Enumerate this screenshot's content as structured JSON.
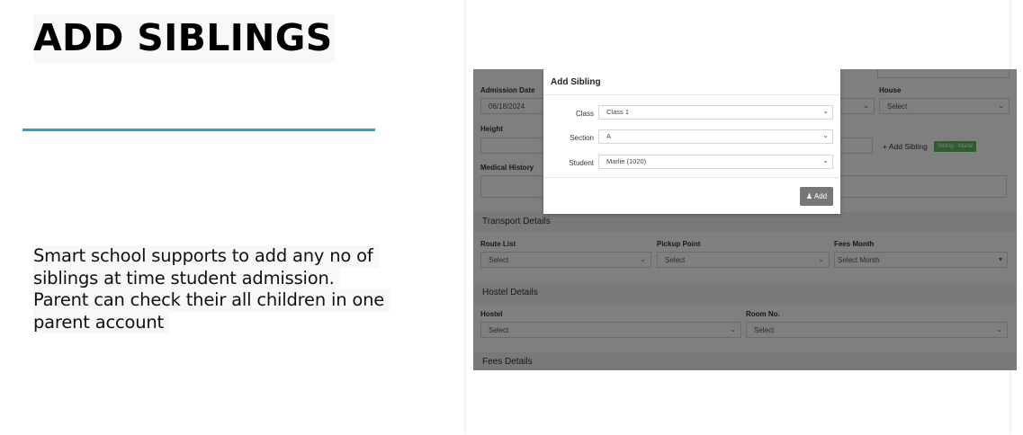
{
  "heading": "ADD SIBLINGS",
  "description_lines": [
    "Smart school supports to add any no of",
    "siblings at time student admission.",
    "Parent can check their all children in one",
    "parent account"
  ],
  "form": {
    "admission_date_label": "Admission Date",
    "admission_date_value": "06/18/2024",
    "house_label": "House",
    "house_value": "Select",
    "height_label": "Height",
    "add_sibling_label": "+ Add Sibling",
    "sibling_badge": "Sibling : Marlie",
    "medical_history_label": "Medical History",
    "transport": {
      "title": "Transport Details",
      "route_list_label": "Route List",
      "route_list_value": "Select",
      "pickup_point_label": "Pickup Point",
      "pickup_point_value": "Select",
      "fees_month_label": "Fees Month",
      "fees_month_value": "Select Month"
    },
    "hostel": {
      "title": "Hostel Details",
      "hostel_label": "Hostel",
      "hostel_value": "Select",
      "room_label": "Room No.",
      "room_value": "Select"
    },
    "fees_title": "Fees Details",
    "unlabeled_select_value": "Select"
  },
  "modal": {
    "title": "Add Sibling",
    "class_label": "Class",
    "class_value": "Class 1",
    "section_label": "Section",
    "section_value": "A",
    "student_label": "Student",
    "student_value": "Marlie (1020)",
    "add_button": "Add",
    "add_icon": "user-icon"
  },
  "colors": {
    "accent_line": "#2aa0d6",
    "badge_green": "#5cb85c",
    "add_button": "#777777"
  }
}
